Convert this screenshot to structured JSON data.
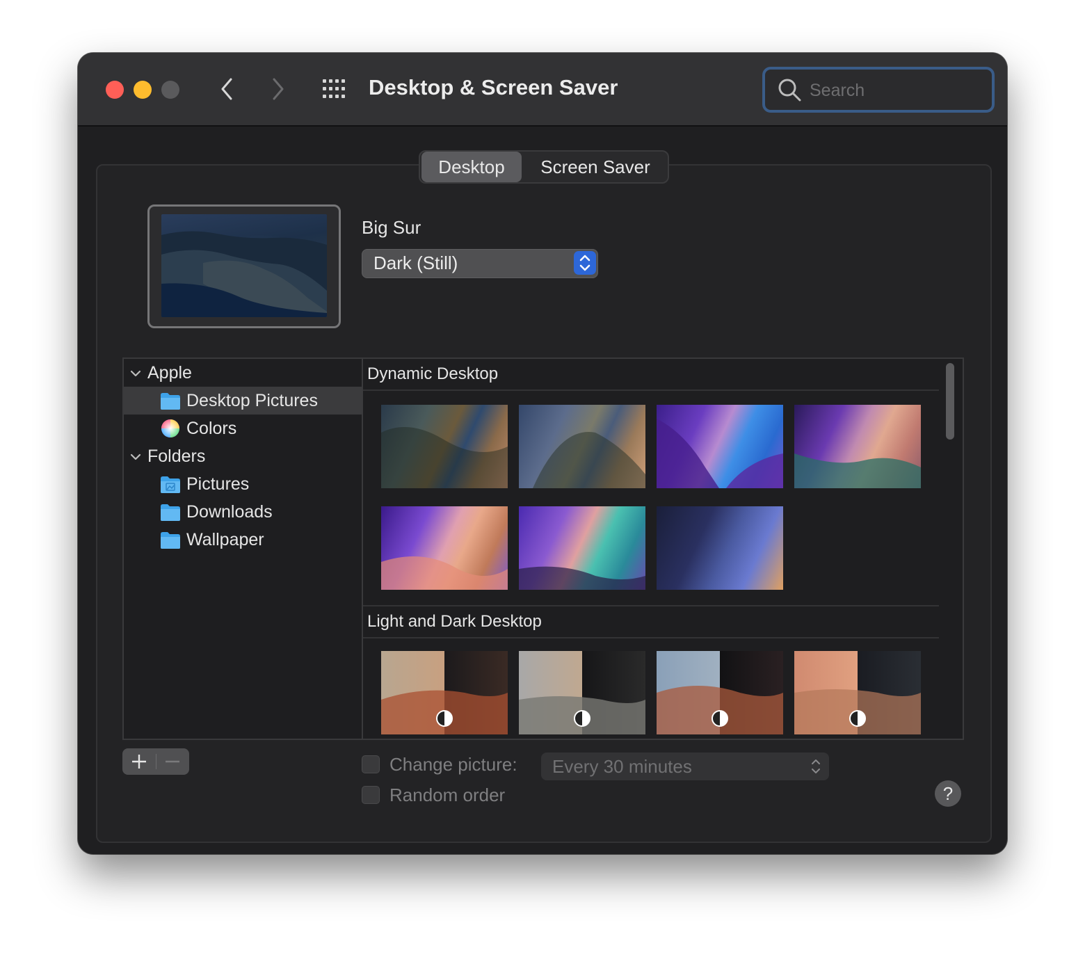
{
  "window": {
    "title": "Desktop & Screen Saver",
    "search_placeholder": "Search"
  },
  "tabs": [
    {
      "label": "Desktop",
      "selected": true
    },
    {
      "label": "Screen Saver",
      "selected": false
    }
  ],
  "current": {
    "wallpaper_name": "Big Sur",
    "variant": "Dark (Still)"
  },
  "sidebar": {
    "groups": [
      {
        "label": "Apple",
        "items": [
          {
            "label": "Desktop Pictures",
            "icon": "folder-icon",
            "selected": true
          },
          {
            "label": "Colors",
            "icon": "color-wheel-icon",
            "selected": false
          }
        ]
      },
      {
        "label": "Folders",
        "items": [
          {
            "label": "Pictures",
            "icon": "pictures-folder-icon",
            "selected": false
          },
          {
            "label": "Downloads",
            "icon": "folder-icon",
            "selected": false
          },
          {
            "label": "Wallpaper",
            "icon": "folder-icon",
            "selected": false
          }
        ]
      }
    ]
  },
  "gallery": {
    "sections": [
      {
        "title": "Dynamic Desktop",
        "count": 7
      },
      {
        "title": "Light and Dark Desktop",
        "count": 4
      }
    ]
  },
  "options": {
    "change_picture_label": "Change picture:",
    "change_picture_checked": false,
    "interval": "Every 30 minutes",
    "random_order_label": "Random order",
    "random_order_checked": false
  },
  "help_label": "?",
  "colors": {
    "close": "#ff5f57",
    "minimize": "#febc2e",
    "accent": "#2d67d8",
    "window_bg": "#1f1f21"
  }
}
